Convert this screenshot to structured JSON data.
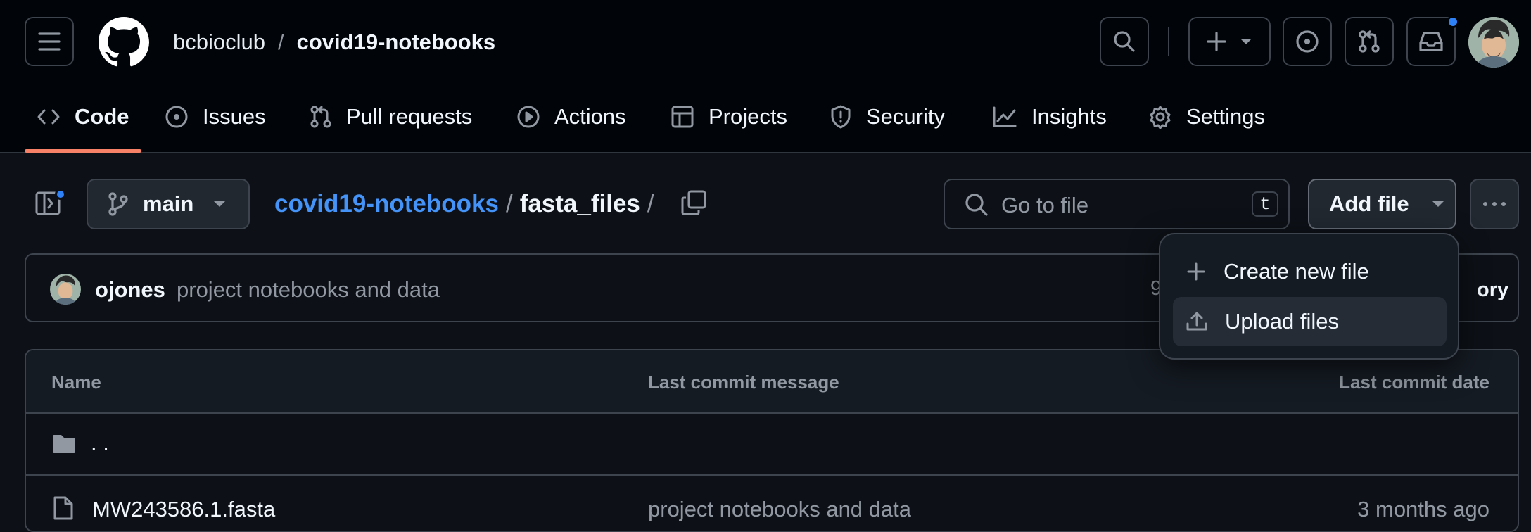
{
  "header": {
    "owner": "bcbioclub",
    "separator": "/",
    "repo": "covid19-notebooks"
  },
  "tabs": [
    {
      "label": "Code",
      "icon": "code-icon",
      "active": true
    },
    {
      "label": "Issues",
      "icon": "issue-icon"
    },
    {
      "label": "Pull requests",
      "icon": "pull-request-icon"
    },
    {
      "label": "Actions",
      "icon": "play-icon"
    },
    {
      "label": "Projects",
      "icon": "table-icon"
    },
    {
      "label": "Security",
      "icon": "shield-icon"
    },
    {
      "label": "Insights",
      "icon": "graph-icon"
    },
    {
      "label": "Settings",
      "icon": "gear-icon"
    }
  ],
  "toolbar": {
    "branch": "main",
    "breadcrumb_repo": "covid19-notebooks",
    "breadcrumb_slash": "/",
    "breadcrumb_folder": "fasta_files",
    "search_placeholder": "Go to file",
    "search_shortcut": "t",
    "add_file_label": "Add file"
  },
  "commit": {
    "author": "ojones",
    "message": "project notebooks and data",
    "hidden_left_fragment": "9",
    "hidden_right_fragment": "ory"
  },
  "dropdown": {
    "items": [
      {
        "label": "Create new file",
        "icon": "plus-icon"
      },
      {
        "label": "Upload files",
        "icon": "upload-icon"
      }
    ]
  },
  "table": {
    "headers": {
      "name": "Name",
      "message": "Last commit message",
      "date": "Last commit date"
    },
    "parent_dir": ". .",
    "rows": [
      {
        "name": "MW243586.1.fasta",
        "message": "project notebooks and data",
        "date": "3 months ago"
      }
    ]
  },
  "colors": {
    "accent_link": "#4493f8",
    "active_tab_underline": "#f78166",
    "notification_dot": "#2f81f7"
  }
}
